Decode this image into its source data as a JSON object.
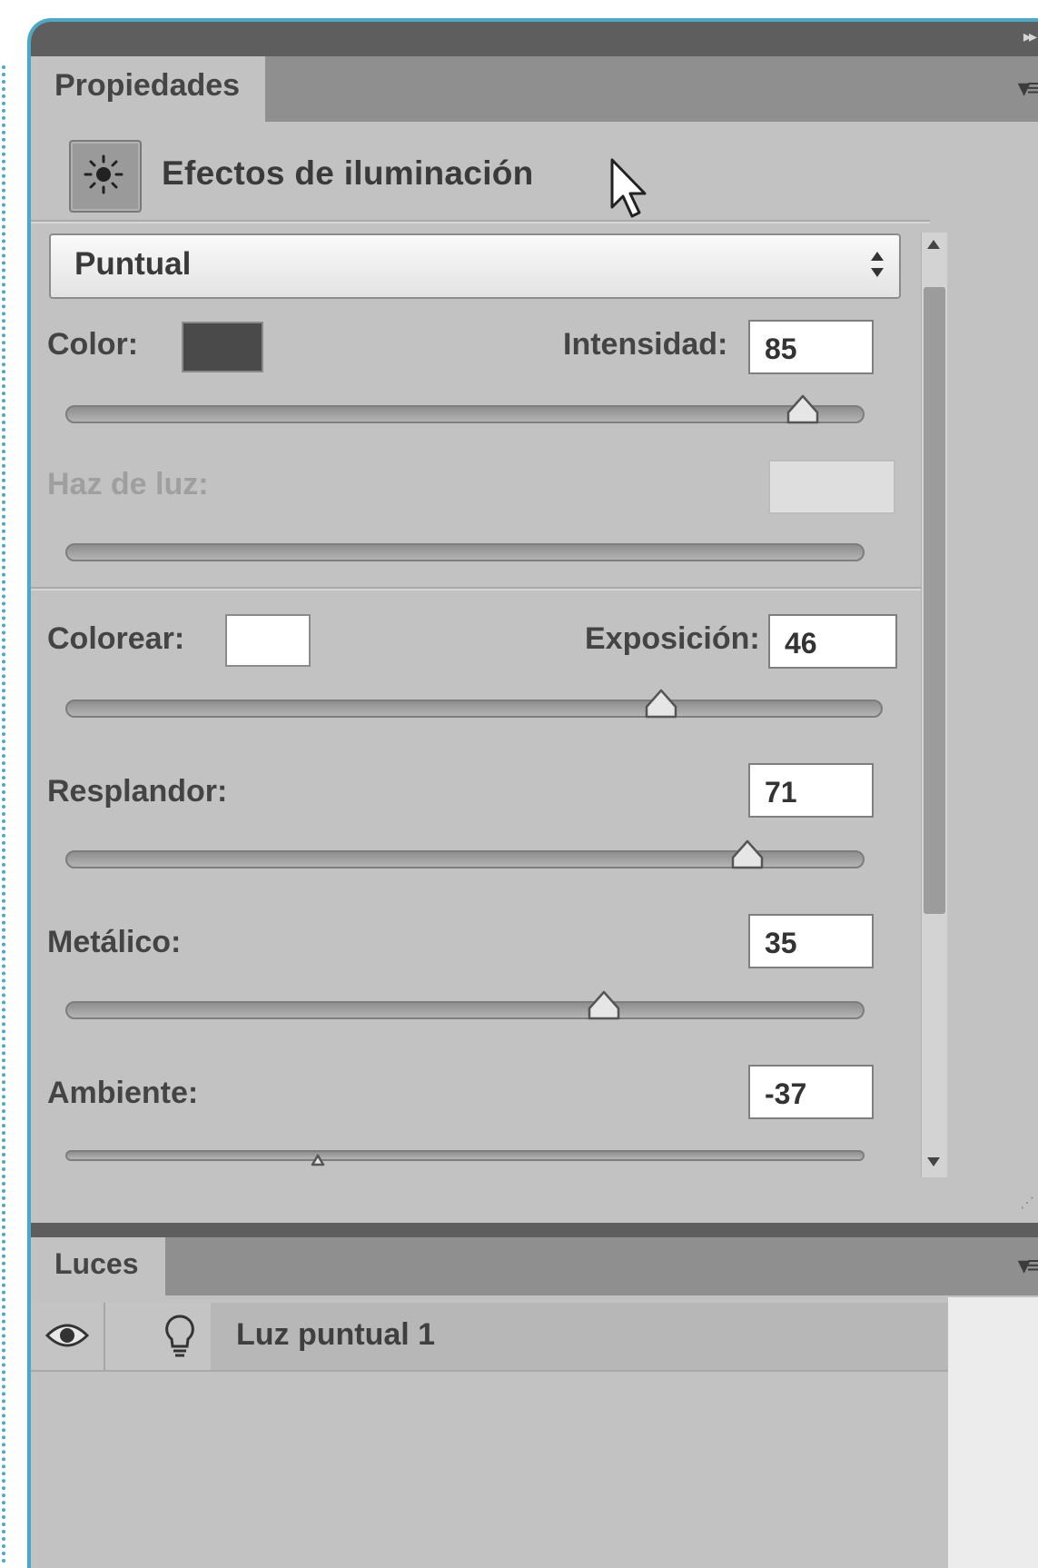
{
  "panel": {
    "tab_label": "Propiedades",
    "title": "Efectos de iluminación"
  },
  "light_type": {
    "selected": "Puntual"
  },
  "color_row": {
    "label": "Color:",
    "swatch_color": "#4a4a4a"
  },
  "intensidad": {
    "label": "Intensidad:",
    "value": "85",
    "slider_fraction": 0.925
  },
  "haz_de_luz": {
    "label": "Haz de luz:",
    "value": ""
  },
  "colorear": {
    "label": "Colorear:",
    "swatch_color": "#ffffff"
  },
  "exposicion": {
    "label": "Exposición:",
    "value": "46",
    "slider_fraction": 0.73
  },
  "resplandor": {
    "label": "Resplandor:",
    "value": "71",
    "slider_fraction": 0.855
  },
  "metalico": {
    "label": "Metálico:",
    "value": "35",
    "slider_fraction": 0.675
  },
  "ambiente": {
    "label": "Ambiente:",
    "value": "-37",
    "slider_fraction": 0.315
  },
  "lights_panel": {
    "tab_label": "Luces",
    "items": [
      {
        "name": "Luz puntual 1",
        "visible": true
      }
    ]
  },
  "colors": {
    "panel_bg": "#c2c2c2",
    "titlebar": "#5e5e5e",
    "accent_border": "#4aa9c9"
  },
  "icons": [
    "light-effects-icon",
    "cursor-arrow-icon",
    "dropdown-arrows-icon",
    "panel-menu-icon",
    "eye-icon",
    "bulb-icon",
    "collapse-icon"
  ]
}
